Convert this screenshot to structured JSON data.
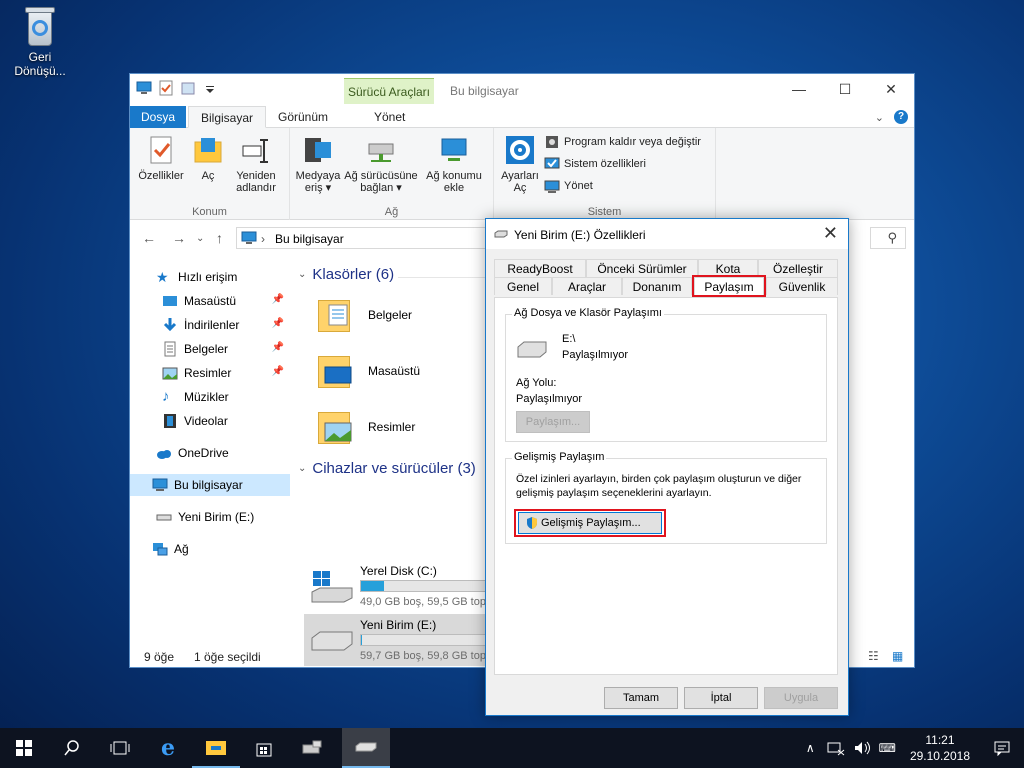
{
  "desktop": {
    "recycle_bin_label": "Geri Dönüşü..."
  },
  "explorer": {
    "window_title": "Bu bilgisayar",
    "context_tab": "Sürücü Araçları",
    "tabs": {
      "file": "Dosya",
      "computer": "Bilgisayar",
      "view": "Görünüm",
      "manage": "Yönet"
    },
    "window_controls": {
      "minimize": "—",
      "maximize": "☐",
      "close": "✕"
    },
    "ribbon": {
      "properties": "Özellikler",
      "open": "Aç",
      "rename_1": "Yeniden",
      "rename_2": "adlandır",
      "group_location": "Konum",
      "media_1": "Medyaya",
      "media_2": "eriş ▾",
      "map_drive_1": "Ağ sürücüsüne",
      "map_drive_2": "bağlan ▾",
      "add_location_1": "Ağ konumu",
      "add_location_2": "ekle",
      "group_network": "Ağ",
      "settings_1": "Ayarları",
      "settings_2": "Aç",
      "uninstall": "Program kaldır veya değiştir",
      "system_props": "Sistem özellikleri",
      "manage": "Yönet",
      "group_system": "Sistem"
    },
    "address": {
      "path": "Bu bilgisayar"
    },
    "nav": {
      "quick_access": "Hızlı erişim",
      "desktop": "Masaüstü",
      "downloads": "İndirilenler",
      "documents": "Belgeler",
      "pictures": "Resimler",
      "music": "Müzikler",
      "videos": "Videolar",
      "onedrive": "OneDrive",
      "this_pc": "Bu bilgisayar",
      "new_volume": "Yeni Birim (E:)",
      "network": "Ağ"
    },
    "content": {
      "folders_header": "Klasörler (6)",
      "folders": [
        "Belgeler",
        "Masaüstü",
        "Resimler"
      ],
      "devices_header": "Cihazlar ve sürücüler (3)",
      "drives": [
        {
          "name": "Yerel Disk (C:)",
          "free": "49,0 GB boş, 59,5 GB top",
          "used_fraction": 0.18
        },
        {
          "name": "Yeni Birim (E:)",
          "free": "59,7 GB boş, 59,8 GB top",
          "used_fraction": 0.01
        }
      ]
    },
    "status": {
      "items": "9 öğe",
      "selected": "1 öğe seçildi"
    }
  },
  "dialog": {
    "title": "Yeni Birim (E:) Özellikleri",
    "close": "✕",
    "tabs_row1": [
      "ReadyBoost",
      "Önceki Sürümler",
      "Kota",
      "Özelleştir"
    ],
    "tabs_row2": [
      "Genel",
      "Araçlar",
      "Donanım",
      "Paylaşım",
      "Güvenlik"
    ],
    "share_group": "Ağ Dosya ve Klasör Paylaşımı",
    "drive_path": "E:\\",
    "share_status": "Paylaşılmıyor",
    "net_path_label": "Ağ Yolu:",
    "net_path_value": "Paylaşılmıyor",
    "share_button": "Paylaşım...",
    "adv_group": "Gelişmiş Paylaşım",
    "adv_desc_1": "Özel izinleri ayarlayın, birden çok paylaşım oluşturun ve diğer",
    "adv_desc_2": "gelişmiş paylaşım seçeneklerini ayarlayın.",
    "adv_button": "Gelişmiş Paylaşım...",
    "ok": "Tamam",
    "cancel": "İptal",
    "apply": "Uygula"
  },
  "taskbar": {
    "time": "11:21",
    "date": "29.10.2018"
  }
}
